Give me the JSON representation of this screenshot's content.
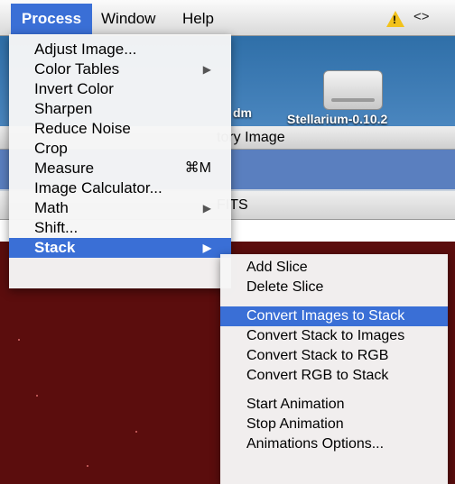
{
  "menubar": {
    "items": [
      "Process",
      "Window",
      "Help"
    ],
    "arrows_glyph": "<>",
    "icons": [
      "warning-icon",
      "arrows-icon"
    ]
  },
  "desktop": {
    "dmg_label": "dm",
    "disk_label": "Stellarium-0.10.2"
  },
  "window1": {
    "title": "tory Image"
  },
  "window2": {
    "title": "FITS"
  },
  "process_menu": {
    "items": [
      {
        "label": "Adjust Image..."
      },
      {
        "label": "Color Tables",
        "submenu": true
      },
      {
        "label": "Invert Color"
      },
      {
        "label": "Sharpen"
      },
      {
        "label": "Reduce Noise"
      },
      {
        "label": "Crop"
      },
      {
        "label": "Measure",
        "shortcut": "⌘M"
      },
      {
        "label": "Image Calculator..."
      },
      {
        "label": "Math",
        "submenu": true
      },
      {
        "label": "Shift..."
      },
      {
        "label": "Stack",
        "submenu": true,
        "selected": true
      }
    ]
  },
  "stack_menu": {
    "groups": [
      [
        "Add Slice",
        "Delete Slice"
      ],
      [
        "Convert Images to Stack",
        "Convert Stack to Images",
        "Convert Stack to RGB",
        "Convert RGB to Stack"
      ],
      [
        "Start Animation",
        "Stop Animation",
        "Animations Options..."
      ]
    ],
    "selected": "Convert Images to Stack"
  },
  "colors": {
    "selection": "#3a6fd6",
    "image_bg": "#5b0d0d",
    "warning": "#f2c21b"
  }
}
